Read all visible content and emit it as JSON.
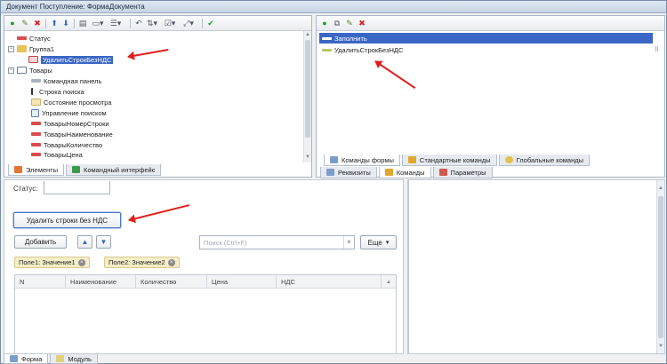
{
  "window": {
    "title": "Документ Поступление: ФормаДокумента"
  },
  "colors": {
    "red_arrow": "#e0201e",
    "selection": "#3a67c5",
    "chip_bg": "#f6edc9"
  },
  "elements_tree": {
    "items": [
      {
        "label": "Статус",
        "icon": "field-icon",
        "level": 1
      },
      {
        "label": "Группа1",
        "icon": "folder-icon",
        "level": 0,
        "expander": "−"
      },
      {
        "label": "УдалитьСтрокБезНДС",
        "icon": "button-icon",
        "level": 1,
        "selected": true
      },
      {
        "label": "Товары",
        "icon": "table-icon",
        "level": 0,
        "expander": "−"
      },
      {
        "label": "Командная панель",
        "icon": "command-bar-icon",
        "level": 1
      },
      {
        "label": "Строка поиска",
        "icon": "search-field-icon",
        "level": 1
      },
      {
        "label": "Состояние просмотра",
        "icon": "view-state-icon",
        "level": 1
      },
      {
        "label": "Управление поиском",
        "icon": "search-control-icon",
        "level": 1
      },
      {
        "label": "ТоварыНомерСтроки",
        "icon": "field-icon",
        "level": 1
      },
      {
        "label": "ТоварыНаименование",
        "icon": "field-icon",
        "level": 1
      },
      {
        "label": "ТоварыКоличество",
        "icon": "field-icon",
        "level": 1
      },
      {
        "label": "ТоварыЦена",
        "icon": "field-icon",
        "level": 1
      }
    ],
    "tabs": [
      "Элементы",
      "Командный интерфейс"
    ]
  },
  "commands_panel": {
    "items": [
      {
        "label": "Заполнить",
        "selected": true
      },
      {
        "label": "УдалитьСтрокБезНДС",
        "selected": false
      }
    ],
    "inner_tabs": [
      "Команды формы",
      "Стандартные команды",
      "Глобальные команды"
    ],
    "outer_tabs": [
      "Реквизиты",
      "Команды",
      "Параметры"
    ]
  },
  "form_preview": {
    "status_label": "Статус:",
    "delete_button": "Удалить строки без НДС",
    "add_button": "Добавить",
    "up_arrow": "▲",
    "down_arrow": "▼",
    "search_placeholder": "Поиск (Ctrl+F)",
    "search_clear": "×",
    "more_button": "Еще",
    "more_caret": "▾",
    "chips": [
      "Поле1: Значение1",
      "Поле2: Значение2"
    ],
    "columns": [
      "N",
      "Наименование",
      "Количество",
      "Цена",
      "НДС"
    ]
  },
  "bottom_tabs": [
    "Форма",
    "Модуль"
  ]
}
